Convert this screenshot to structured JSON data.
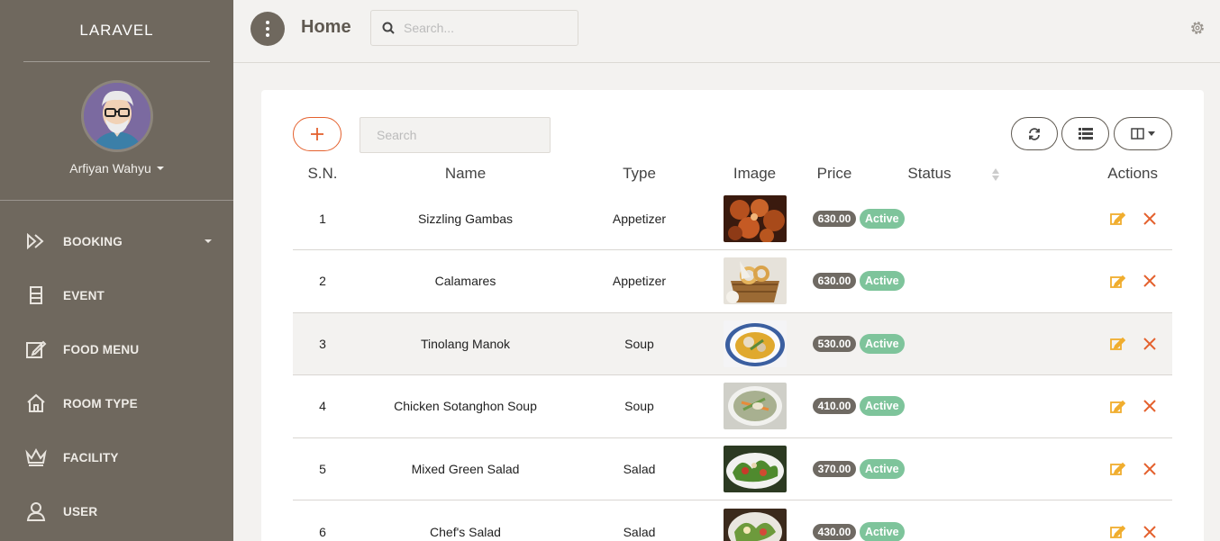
{
  "sidebar": {
    "brand": "LARAVEL",
    "user_name": "Arfiyan Wahyu",
    "items": [
      {
        "label": "BOOKING",
        "icon": "booking-icon"
      },
      {
        "label": "EVENT",
        "icon": "event-icon"
      },
      {
        "label": "FOOD MENU",
        "icon": "food-menu-icon"
      },
      {
        "label": "ROOM TYPE",
        "icon": "room-type-icon"
      },
      {
        "label": "FACILITY",
        "icon": "facility-icon"
      },
      {
        "label": "USER",
        "icon": "user-icon"
      }
    ]
  },
  "header": {
    "title": "Home",
    "search_placeholder": "Search..."
  },
  "toolbar": {
    "search_placeholder": "Search"
  },
  "table": {
    "columns": [
      "S.N.",
      "Name",
      "Type",
      "Image",
      "Price",
      "Status",
      "",
      "Actions"
    ],
    "rows": [
      {
        "sn": "1",
        "name": "Sizzling Gambas",
        "type": "Appetizer",
        "price": "630.00",
        "status": "Active"
      },
      {
        "sn": "2",
        "name": "Calamares",
        "type": "Appetizer",
        "price": "630.00",
        "status": "Active"
      },
      {
        "sn": "3",
        "name": "Tinolang Manok",
        "type": "Soup",
        "price": "530.00",
        "status": "Active"
      },
      {
        "sn": "4",
        "name": "Chicken Sotanghon Soup",
        "type": "Soup",
        "price": "410.00",
        "status": "Active"
      },
      {
        "sn": "5",
        "name": "Mixed Green Salad",
        "type": "Salad",
        "price": "370.00",
        "status": "Active"
      },
      {
        "sn": "6",
        "name": "Chef's Salad",
        "type": "Salad",
        "price": "430.00",
        "status": "Active"
      }
    ]
  },
  "colors": {
    "sidebar_bg": "#6f685e",
    "accent_orange": "#e4612e",
    "status_green": "#7ec49b",
    "edit_yellow": "#f0ad2e"
  }
}
